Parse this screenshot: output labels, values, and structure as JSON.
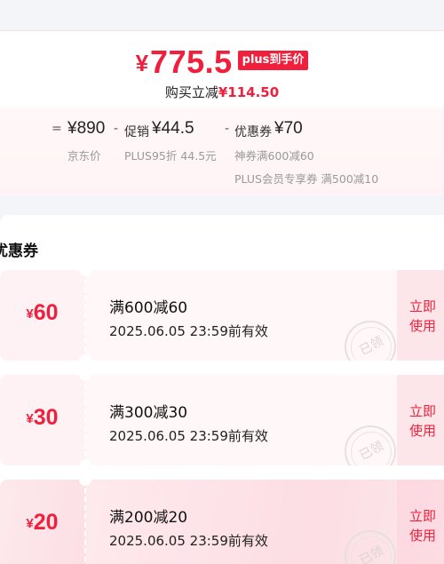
{
  "price": {
    "currency": "¥",
    "final_price": "775.5",
    "plus_tag": "plus到手价",
    "save_label": "购买立减",
    "save_amount": "¥114.50"
  },
  "breakdown": {
    "eq": "=",
    "jd_price": "¥890",
    "jd_label": "京东价",
    "minus1": "-",
    "promo_label": "促销",
    "promo_value": "¥44.5",
    "promo_sub": "PLUS95折 44.5元",
    "minus2": "-",
    "coupon_label": "优惠券",
    "coupon_value": "¥70",
    "coupon_sub1": "神券满600减60",
    "coupon_sub2": "PLUS会员专享券 满500减10"
  },
  "coupons_section": {
    "title": "优惠券",
    "items": [
      {
        "currency": "¥",
        "amount": "60",
        "condition": "满600减60",
        "validity": "2025.06.05 23:59前有效",
        "button": "立即使用",
        "stamp": "已领"
      },
      {
        "currency": "¥",
        "amount": "30",
        "condition": "满300减30",
        "validity": "2025.06.05 23:59前有效",
        "button": "立即使用",
        "stamp": "已领"
      },
      {
        "currency": "¥",
        "amount": "20",
        "condition": "满200减20",
        "validity": "2025.06.05 23:59前有效",
        "button": "立即使用",
        "stamp": "已领"
      }
    ]
  },
  "colors": {
    "accent": "#f0203c",
    "coupon_bg": "#fff2f4"
  }
}
